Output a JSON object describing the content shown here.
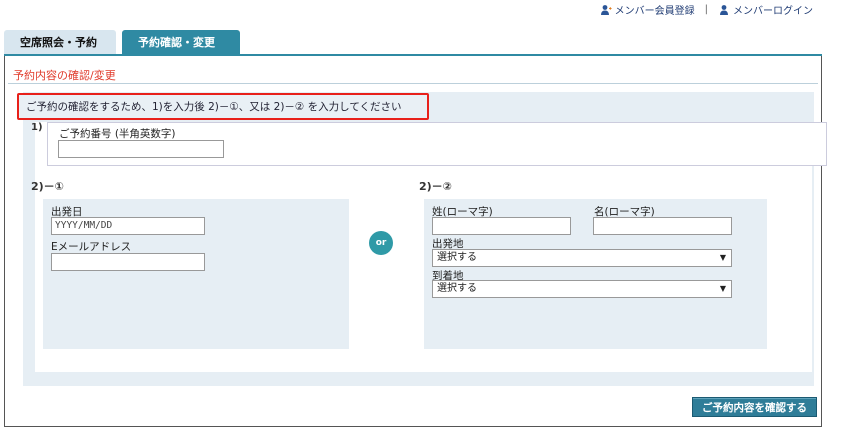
{
  "header": {
    "member_register": "メンバー会員登録",
    "separator": "|",
    "member_login": "メンバーログイン"
  },
  "tabs": [
    {
      "label": "空席照会・予約",
      "active": false
    },
    {
      "label": "予約確認・変更",
      "active": true
    }
  ],
  "panel": {
    "title": "予約内容の確認/変更",
    "notice": "ご予約の確認をするため、1)を入力後 2)－①、又は 2)－② を入力してください"
  },
  "section1": {
    "label": "1)",
    "reservation_label": "ご予約番号 (半角英数字)",
    "reservation_value": ""
  },
  "section2a": {
    "label": "2)－①",
    "departure_date_label": "出発日",
    "departure_date_placeholder": "YYYY/MM/DD",
    "email_label": "Eメールアドレス",
    "email_value": ""
  },
  "or_label": "or",
  "section2b": {
    "label": "2)－②",
    "surname_label": "姓(ローマ字)",
    "given_name_label": "名(ローマ字)",
    "origin_label": "出発地",
    "origin_value": "選択する",
    "destination_label": "到着地",
    "destination_value": "選択する"
  },
  "confirm_button": "ご予約内容を確認する",
  "colors": {
    "accent": "#2f8aa3",
    "title_red": "#e03a2a",
    "notice_border": "#e8201a",
    "panel_bg": "#e6eef4",
    "button": "#2f7d98"
  },
  "icons": {
    "register": "person-plus-icon",
    "login": "person-icon",
    "select_arrow": "caret-down-icon"
  }
}
